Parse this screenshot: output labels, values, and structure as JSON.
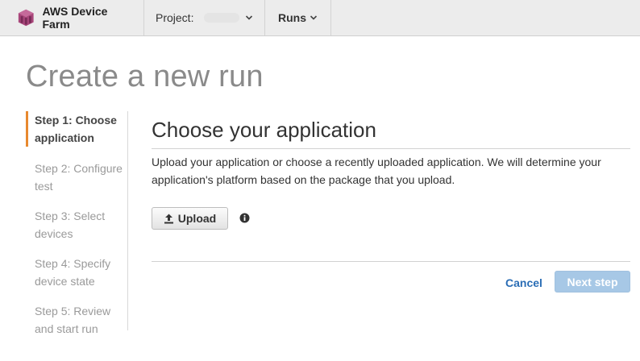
{
  "nav": {
    "brand": "AWS Device Farm",
    "project_label": "Project:",
    "project_value": "",
    "runs_label": "Runs"
  },
  "page": {
    "title": "Create a new run"
  },
  "steps": [
    {
      "label": "Step 1: Choose application",
      "active": true
    },
    {
      "label": "Step 2: Configure test",
      "active": false
    },
    {
      "label": "Step 3: Select devices",
      "active": false
    },
    {
      "label": "Step 4: Specify device state",
      "active": false
    },
    {
      "label": "Step 5: Review and start run",
      "active": false
    }
  ],
  "main": {
    "section_title": "Choose your application",
    "description": "Upload your application or choose a recently uploaded application. We will determine your application's platform based on the package that you upload.",
    "upload_label": "Upload",
    "upload_icon": "upload-icon",
    "info_icon": "info-icon"
  },
  "footer": {
    "cancel_label": "Cancel",
    "next_label": "Next step"
  },
  "colors": {
    "active_step_marker": "#e8892f",
    "link": "#2a6db5",
    "disabled_primary": "#a7c8e6"
  }
}
